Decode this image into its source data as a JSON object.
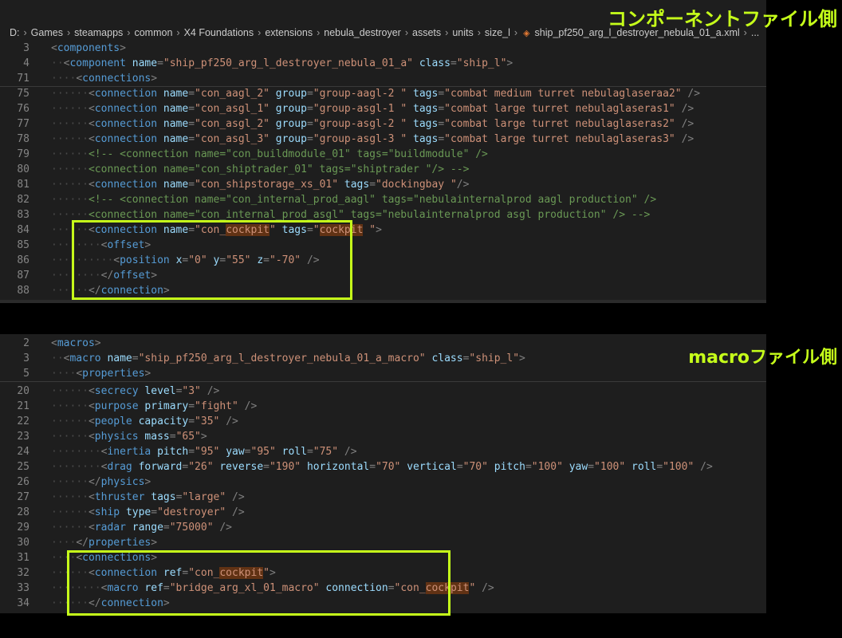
{
  "breadcrumb": [
    "D:",
    "Games",
    "steamapps",
    "common",
    "X4 Foundations",
    "extensions",
    "nebula_destroyer",
    "assets",
    "units",
    "size_l",
    "ship_pf250_arg_l_destroyer_nebula_01_a.xml",
    "..."
  ],
  "callouts": {
    "component": "コンポーネントファイル側",
    "macro": "macroファイル側"
  },
  "colors": {
    "highlight_box": "#c6ff1a",
    "search_match": "#613214"
  },
  "component_sticky_lines": [
    {
      "num": "3",
      "indent": 1,
      "tokens": [
        [
          "p",
          "<"
        ],
        [
          "t",
          "components"
        ],
        [
          "p",
          ">"
        ]
      ]
    },
    {
      "num": "4",
      "indent": 2,
      "tokens": [
        [
          "p",
          "<"
        ],
        [
          "t",
          "component"
        ],
        [
          "s",
          " "
        ],
        [
          "a",
          "name"
        ],
        [
          "p",
          "="
        ],
        [
          "v",
          "\"ship_pf250_arg_l_destroyer_nebula_01_a\""
        ],
        [
          "s",
          " "
        ],
        [
          "a",
          "class"
        ],
        [
          "p",
          "="
        ],
        [
          "v",
          "\"ship_l\""
        ],
        [
          "p",
          ">"
        ]
      ]
    },
    {
      "num": "71",
      "indent": 3,
      "tokens": [
        [
          "p",
          "<"
        ],
        [
          "t",
          "connections"
        ],
        [
          "p",
          ">"
        ]
      ]
    }
  ],
  "component_lines": [
    {
      "num": "75",
      "indent": 4,
      "tokens": [
        [
          "p",
          "<"
        ],
        [
          "t",
          "connection"
        ],
        [
          "s",
          " "
        ],
        [
          "a",
          "name"
        ],
        [
          "p",
          "="
        ],
        [
          "v",
          "\"con_aagl_2\""
        ],
        [
          "s",
          " "
        ],
        [
          "a",
          "group"
        ],
        [
          "p",
          "="
        ],
        [
          "v",
          "\"group-aagl-2 \""
        ],
        [
          "s",
          " "
        ],
        [
          "a",
          "tags"
        ],
        [
          "p",
          "="
        ],
        [
          "v",
          "\"combat medium turret nebulaglaseraa2\""
        ],
        [
          "s",
          " "
        ],
        [
          "p",
          "/>"
        ]
      ]
    },
    {
      "num": "76",
      "indent": 4,
      "tokens": [
        [
          "p",
          "<"
        ],
        [
          "t",
          "connection"
        ],
        [
          "s",
          " "
        ],
        [
          "a",
          "name"
        ],
        [
          "p",
          "="
        ],
        [
          "v",
          "\"con_asgl_1\""
        ],
        [
          "s",
          " "
        ],
        [
          "a",
          "group"
        ],
        [
          "p",
          "="
        ],
        [
          "v",
          "\"group-asgl-1 \""
        ],
        [
          "s",
          " "
        ],
        [
          "a",
          "tags"
        ],
        [
          "p",
          "="
        ],
        [
          "v",
          "\"combat large turret nebulaglaseras1\""
        ],
        [
          "s",
          " "
        ],
        [
          "p",
          "/>"
        ]
      ]
    },
    {
      "num": "77",
      "indent": 4,
      "tokens": [
        [
          "p",
          "<"
        ],
        [
          "t",
          "connection"
        ],
        [
          "s",
          " "
        ],
        [
          "a",
          "name"
        ],
        [
          "p",
          "="
        ],
        [
          "v",
          "\"con_asgl_2\""
        ],
        [
          "s",
          " "
        ],
        [
          "a",
          "group"
        ],
        [
          "p",
          "="
        ],
        [
          "v",
          "\"group-asgl-2 \""
        ],
        [
          "s",
          " "
        ],
        [
          "a",
          "tags"
        ],
        [
          "p",
          "="
        ],
        [
          "v",
          "\"combat large turret nebulaglaseras2\""
        ],
        [
          "s",
          " "
        ],
        [
          "p",
          "/>"
        ]
      ]
    },
    {
      "num": "78",
      "indent": 4,
      "tokens": [
        [
          "p",
          "<"
        ],
        [
          "t",
          "connection"
        ],
        [
          "s",
          " "
        ],
        [
          "a",
          "name"
        ],
        [
          "p",
          "="
        ],
        [
          "v",
          "\"con_asgl_3\""
        ],
        [
          "s",
          " "
        ],
        [
          "a",
          "group"
        ],
        [
          "p",
          "="
        ],
        [
          "v",
          "\"group-asgl-3 \""
        ],
        [
          "s",
          " "
        ],
        [
          "a",
          "tags"
        ],
        [
          "p",
          "="
        ],
        [
          "v",
          "\"combat large turret nebulaglaseras3\""
        ],
        [
          "s",
          " "
        ],
        [
          "p",
          "/>"
        ]
      ]
    },
    {
      "num": "79",
      "indent": 4,
      "tokens": [
        [
          "c",
          "<!-- <connection name=\"con_buildmodule_01\" tags=\"buildmodule\" />"
        ]
      ]
    },
    {
      "num": "80",
      "indent": 4,
      "tokens": [
        [
          "c",
          "<connection name=\"con_shiptrader_01\" tags=\"shiptrader \"/> -->"
        ]
      ]
    },
    {
      "num": "81",
      "indent": 4,
      "tokens": [
        [
          "p",
          "<"
        ],
        [
          "t",
          "connection"
        ],
        [
          "s",
          " "
        ],
        [
          "a",
          "name"
        ],
        [
          "p",
          "="
        ],
        [
          "v",
          "\"con_shipstorage_xs_01\""
        ],
        [
          "s",
          " "
        ],
        [
          "a",
          "tags"
        ],
        [
          "p",
          "="
        ],
        [
          "v",
          "\"dockingbay \""
        ],
        [
          "p",
          "/>"
        ]
      ]
    },
    {
      "num": "82",
      "indent": 4,
      "tokens": [
        [
          "c",
          "<!-- <connection name=\"con_internal_prod_aagl\" tags=\"nebulainternalprod aagl production\" />"
        ]
      ]
    },
    {
      "num": "83",
      "indent": 4,
      "tokens": [
        [
          "c",
          "<connection name=\"con_internal_prod_asgl\" tags=\"nebulainternalprod asgl production\" /> -->"
        ]
      ]
    },
    {
      "num": "84",
      "indent": 4,
      "tokens": [
        [
          "p",
          "<"
        ],
        [
          "t",
          "connection"
        ],
        [
          "s",
          " "
        ],
        [
          "a",
          "name"
        ],
        [
          "p",
          "="
        ],
        [
          "v",
          "\"con_"
        ],
        [
          "h",
          "cockpit"
        ],
        [
          "v",
          "\""
        ],
        [
          "s",
          " "
        ],
        [
          "a",
          "tags"
        ],
        [
          "p",
          "="
        ],
        [
          "v",
          "\""
        ],
        [
          "h",
          "cockpit"
        ],
        [
          "v",
          " \""
        ],
        [
          "p",
          ">"
        ]
      ]
    },
    {
      "num": "85",
      "indent": 5,
      "tokens": [
        [
          "p",
          "<"
        ],
        [
          "t",
          "offset"
        ],
        [
          "p",
          ">"
        ]
      ]
    },
    {
      "num": "86",
      "indent": 6,
      "tokens": [
        [
          "p",
          "<"
        ],
        [
          "t",
          "position"
        ],
        [
          "s",
          " "
        ],
        [
          "a",
          "x"
        ],
        [
          "p",
          "="
        ],
        [
          "v",
          "\"0\""
        ],
        [
          "s",
          " "
        ],
        [
          "a",
          "y"
        ],
        [
          "p",
          "="
        ],
        [
          "v",
          "\"55\""
        ],
        [
          "s",
          " "
        ],
        [
          "a",
          "z"
        ],
        [
          "p",
          "="
        ],
        [
          "v",
          "\"-70\""
        ],
        [
          "s",
          " "
        ],
        [
          "p",
          "/>"
        ]
      ]
    },
    {
      "num": "87",
      "indent": 5,
      "tokens": [
        [
          "p",
          "</"
        ],
        [
          "t",
          "offset"
        ],
        [
          "p",
          ">"
        ]
      ]
    },
    {
      "num": "88",
      "indent": 4,
      "tokens": [
        [
          "p",
          "</"
        ],
        [
          "t",
          "connection"
        ],
        [
          "p",
          ">"
        ]
      ]
    }
  ],
  "macro_sticky_lines": [
    {
      "num": "2",
      "indent": 1,
      "tokens": [
        [
          "p",
          "<"
        ],
        [
          "t",
          "macros"
        ],
        [
          "p",
          ">"
        ]
      ]
    },
    {
      "num": "3",
      "indent": 2,
      "tokens": [
        [
          "p",
          "<"
        ],
        [
          "t",
          "macro"
        ],
        [
          "s",
          " "
        ],
        [
          "a",
          "name"
        ],
        [
          "p",
          "="
        ],
        [
          "v",
          "\"ship_pf250_arg_l_destroyer_nebula_01_a_macro\""
        ],
        [
          "s",
          " "
        ],
        [
          "a",
          "class"
        ],
        [
          "p",
          "="
        ],
        [
          "v",
          "\"ship_l\""
        ],
        [
          "p",
          ">"
        ]
      ]
    },
    {
      "num": "5",
      "indent": 3,
      "tokens": [
        [
          "p",
          "<"
        ],
        [
          "t",
          "properties"
        ],
        [
          "p",
          ">"
        ]
      ]
    }
  ],
  "macro_lines": [
    {
      "num": "20",
      "indent": 4,
      "tokens": [
        [
          "p",
          "<"
        ],
        [
          "t",
          "secrecy"
        ],
        [
          "s",
          " "
        ],
        [
          "a",
          "level"
        ],
        [
          "p",
          "="
        ],
        [
          "v",
          "\"3\""
        ],
        [
          "s",
          " "
        ],
        [
          "p",
          "/>"
        ]
      ]
    },
    {
      "num": "21",
      "indent": 4,
      "tokens": [
        [
          "p",
          "<"
        ],
        [
          "t",
          "purpose"
        ],
        [
          "s",
          " "
        ],
        [
          "a",
          "primary"
        ],
        [
          "p",
          "="
        ],
        [
          "v",
          "\"fight\""
        ],
        [
          "s",
          " "
        ],
        [
          "p",
          "/>"
        ]
      ]
    },
    {
      "num": "22",
      "indent": 4,
      "tokens": [
        [
          "p",
          "<"
        ],
        [
          "t",
          "people"
        ],
        [
          "s",
          " "
        ],
        [
          "a",
          "capacity"
        ],
        [
          "p",
          "="
        ],
        [
          "v",
          "\"35\""
        ],
        [
          "s",
          " "
        ],
        [
          "p",
          "/>"
        ]
      ]
    },
    {
      "num": "23",
      "indent": 4,
      "tokens": [
        [
          "p",
          "<"
        ],
        [
          "t",
          "physics"
        ],
        [
          "s",
          " "
        ],
        [
          "a",
          "mass"
        ],
        [
          "p",
          "="
        ],
        [
          "v",
          "\"65\""
        ],
        [
          "p",
          ">"
        ]
      ]
    },
    {
      "num": "24",
      "indent": 5,
      "tokens": [
        [
          "p",
          "<"
        ],
        [
          "t",
          "inertia"
        ],
        [
          "s",
          " "
        ],
        [
          "a",
          "pitch"
        ],
        [
          "p",
          "="
        ],
        [
          "v",
          "\"95\""
        ],
        [
          "s",
          " "
        ],
        [
          "a",
          "yaw"
        ],
        [
          "p",
          "="
        ],
        [
          "v",
          "\"95\""
        ],
        [
          "s",
          " "
        ],
        [
          "a",
          "roll"
        ],
        [
          "p",
          "="
        ],
        [
          "v",
          "\"75\""
        ],
        [
          "s",
          " "
        ],
        [
          "p",
          "/>"
        ]
      ]
    },
    {
      "num": "25",
      "indent": 5,
      "tokens": [
        [
          "p",
          "<"
        ],
        [
          "t",
          "drag"
        ],
        [
          "s",
          " "
        ],
        [
          "a",
          "forward"
        ],
        [
          "p",
          "="
        ],
        [
          "v",
          "\"26\""
        ],
        [
          "s",
          " "
        ],
        [
          "a",
          "reverse"
        ],
        [
          "p",
          "="
        ],
        [
          "v",
          "\"190\""
        ],
        [
          "s",
          " "
        ],
        [
          "a",
          "horizontal"
        ],
        [
          "p",
          "="
        ],
        [
          "v",
          "\"70\""
        ],
        [
          "s",
          " "
        ],
        [
          "a",
          "vertical"
        ],
        [
          "p",
          "="
        ],
        [
          "v",
          "\"70\""
        ],
        [
          "s",
          " "
        ],
        [
          "a",
          "pitch"
        ],
        [
          "p",
          "="
        ],
        [
          "v",
          "\"100\""
        ],
        [
          "s",
          " "
        ],
        [
          "a",
          "yaw"
        ],
        [
          "p",
          "="
        ],
        [
          "v",
          "\"100\""
        ],
        [
          "s",
          " "
        ],
        [
          "a",
          "roll"
        ],
        [
          "p",
          "="
        ],
        [
          "v",
          "\"100\""
        ],
        [
          "s",
          " "
        ],
        [
          "p",
          "/>"
        ]
      ]
    },
    {
      "num": "26",
      "indent": 4,
      "tokens": [
        [
          "p",
          "</"
        ],
        [
          "t",
          "physics"
        ],
        [
          "p",
          ">"
        ]
      ]
    },
    {
      "num": "27",
      "indent": 4,
      "tokens": [
        [
          "p",
          "<"
        ],
        [
          "t",
          "thruster"
        ],
        [
          "s",
          " "
        ],
        [
          "a",
          "tags"
        ],
        [
          "p",
          "="
        ],
        [
          "v",
          "\"large\""
        ],
        [
          "s",
          " "
        ],
        [
          "p",
          "/>"
        ]
      ]
    },
    {
      "num": "28",
      "indent": 4,
      "tokens": [
        [
          "p",
          "<"
        ],
        [
          "t",
          "ship"
        ],
        [
          "s",
          " "
        ],
        [
          "a",
          "type"
        ],
        [
          "p",
          "="
        ],
        [
          "v",
          "\"destroyer\""
        ],
        [
          "s",
          " "
        ],
        [
          "p",
          "/>"
        ]
      ]
    },
    {
      "num": "29",
      "indent": 4,
      "tokens": [
        [
          "p",
          "<"
        ],
        [
          "t",
          "radar"
        ],
        [
          "s",
          " "
        ],
        [
          "a",
          "range"
        ],
        [
          "p",
          "="
        ],
        [
          "v",
          "\"75000\""
        ],
        [
          "s",
          " "
        ],
        [
          "p",
          "/>"
        ]
      ]
    },
    {
      "num": "30",
      "indent": 3,
      "tokens": [
        [
          "p",
          "</"
        ],
        [
          "t",
          "properties"
        ],
        [
          "p",
          ">"
        ]
      ]
    },
    {
      "num": "31",
      "indent": 3,
      "tokens": [
        [
          "p",
          "<"
        ],
        [
          "t",
          "connections"
        ],
        [
          "p",
          ">"
        ]
      ]
    },
    {
      "num": "32",
      "indent": 4,
      "tokens": [
        [
          "p",
          "<"
        ],
        [
          "t",
          "connection"
        ],
        [
          "s",
          " "
        ],
        [
          "a",
          "ref"
        ],
        [
          "p",
          "="
        ],
        [
          "v",
          "\"con_"
        ],
        [
          "h",
          "cockpit"
        ],
        [
          "v",
          "\""
        ],
        [
          "p",
          ">"
        ]
      ]
    },
    {
      "num": "33",
      "indent": 5,
      "tokens": [
        [
          "p",
          "<"
        ],
        [
          "t",
          "macro"
        ],
        [
          "s",
          " "
        ],
        [
          "a",
          "ref"
        ],
        [
          "p",
          "="
        ],
        [
          "v",
          "\"bridge_arg_xl_01_macro\""
        ],
        [
          "s",
          " "
        ],
        [
          "a",
          "connection"
        ],
        [
          "p",
          "="
        ],
        [
          "v",
          "\"con_"
        ],
        [
          "h",
          "cockpit"
        ],
        [
          "v",
          "\""
        ],
        [
          "s",
          " "
        ],
        [
          "p",
          "/>"
        ]
      ]
    },
    {
      "num": "34",
      "indent": 4,
      "tokens": [
        [
          "p",
          "</"
        ],
        [
          "t",
          "connection"
        ],
        [
          "p",
          ">"
        ]
      ]
    }
  ]
}
